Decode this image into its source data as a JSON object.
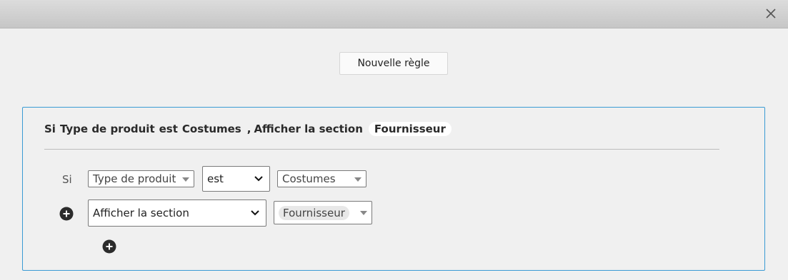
{
  "dialog": {
    "close_icon": "close-icon"
  },
  "toolbar": {
    "new_rule_label": "Nouvelle règle"
  },
  "rule": {
    "summary": {
      "si": "Si",
      "field": "Type de produit",
      "operator": "est",
      "value": "Costumes",
      "separator": ",",
      "action": "Afficher la section",
      "target": "Fournisseur"
    },
    "condition": {
      "si_label": "Si",
      "field": "Type de produit",
      "operator": "est",
      "value": "Costumes"
    },
    "action": {
      "type": "Afficher la section",
      "target": "Fournisseur"
    },
    "add_condition_icon": "plus-circle-icon",
    "add_action_icon": "plus-circle-icon"
  },
  "colors": {
    "panel_border": "#3a9bd4",
    "titlebar": "#c6c6c6",
    "background": "#f0f0f0"
  }
}
